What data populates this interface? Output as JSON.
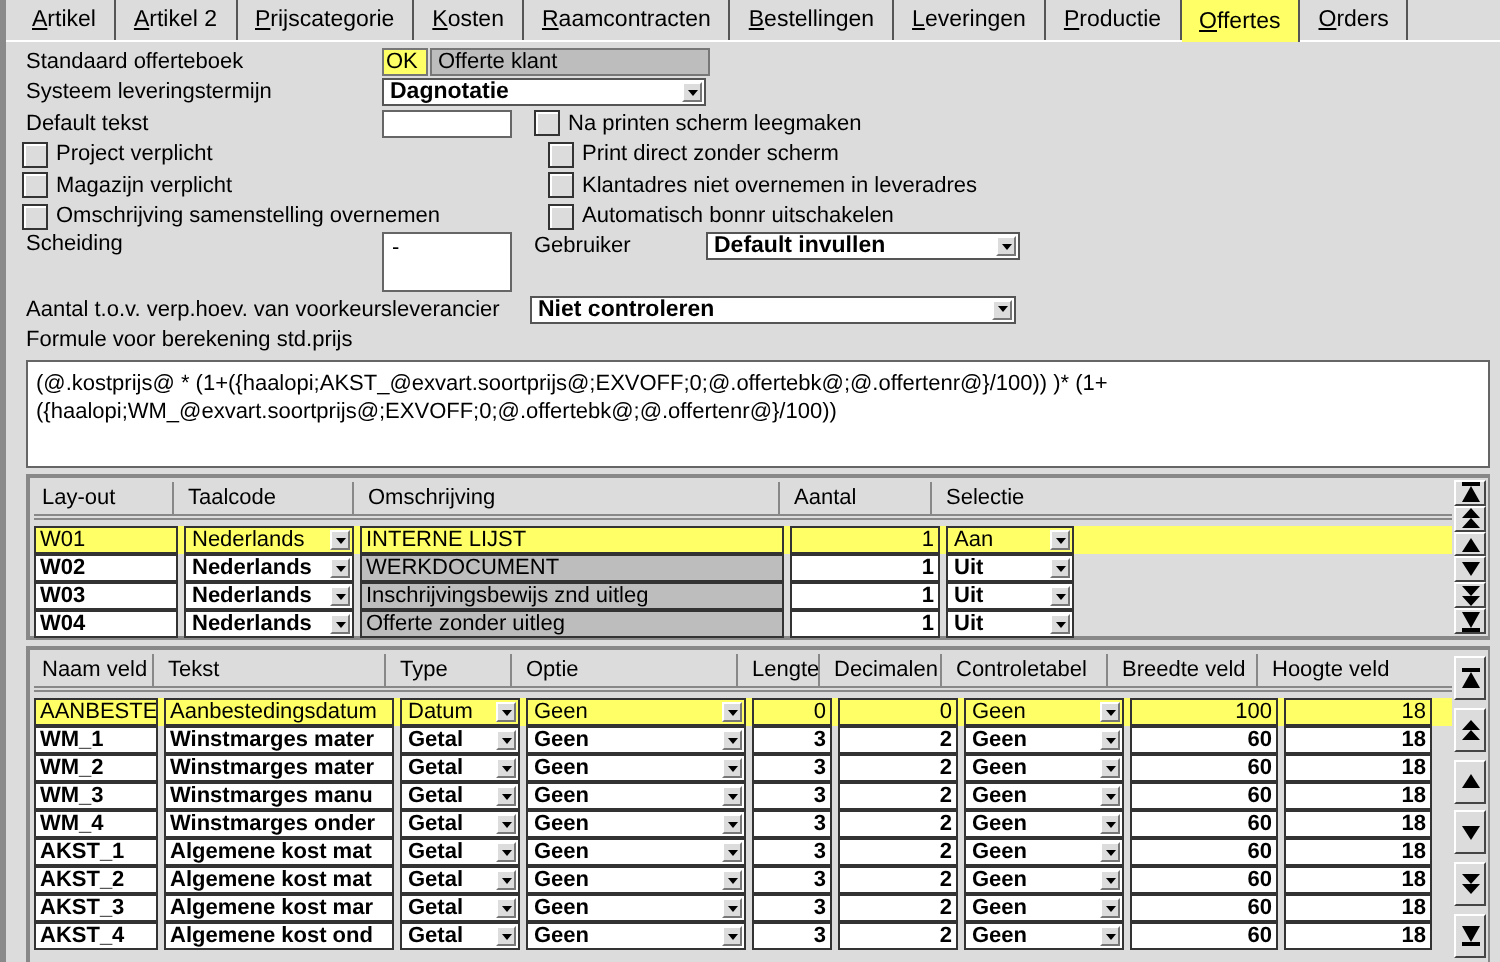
{
  "tabs": [
    {
      "label": "Artikel",
      "selected": false
    },
    {
      "label": "Artikel 2",
      "selected": false
    },
    {
      "label": "Prijscategorie",
      "selected": false
    },
    {
      "label": "Kosten",
      "selected": false
    },
    {
      "label": "Raamcontracten",
      "selected": false
    },
    {
      "label": "Bestellingen",
      "selected": false
    },
    {
      "label": "Leveringen",
      "selected": false
    },
    {
      "label": "Productie",
      "selected": false
    },
    {
      "label": "Offertes",
      "selected": true
    },
    {
      "label": "Orders",
      "selected": false
    }
  ],
  "form": {
    "standaard_offerteboek": {
      "label": "Standaard offerteboek",
      "code": "OK",
      "value": "Offerte klant"
    },
    "systeem_leveringstermijn": {
      "label": "Systeem leveringstermijn",
      "value": "Dagnotatie"
    },
    "default_tekst": {
      "label": "Default tekst"
    },
    "checkboxes_left": [
      {
        "label": "Project verplicht",
        "checked": false
      },
      {
        "label": "Magazijn verplicht",
        "checked": false
      },
      {
        "label": "Omschrijving samenstelling overnemen",
        "checked": false
      }
    ],
    "checkboxes_right": [
      {
        "label": "Na printen scherm leegmaken",
        "checked": false
      },
      {
        "label": "Print direct zonder scherm",
        "checked": false
      },
      {
        "label": "Klantadres niet overnemen in leveradres",
        "checked": false
      },
      {
        "label": "Automatisch bonnr uitschakelen",
        "checked": false
      }
    ],
    "scheiding": {
      "label": "Scheiding",
      "value": "-"
    },
    "gebruiker": {
      "label": "Gebruiker",
      "value": "Default invullen"
    },
    "aantal": {
      "label": "Aantal t.o.v. verp.hoev. van voorkeursleverancier",
      "value": "Niet controleren"
    },
    "formule": {
      "label": "Formule voor berekening std.prijs",
      "value": "(@.kostprijs@ * (1+({haalopi;AKST_@exvart.soortprijs@;EXVOFF;0;@.offertebk@;@.offertenr@}/100)) )* (1+({haalopi;WM_@exvart.soortprijs@;EXVOFF;0;@.offertebk@;@.offertenr@}/100))"
    }
  },
  "layout_table": {
    "columns": [
      "Lay-out",
      "Taalcode",
      "Omschrijving",
      "Aantal",
      "Selectie"
    ],
    "rows": [
      {
        "layout": "W01",
        "taalcode": "Nederlands",
        "omschrijving": "INTERNE LIJST",
        "aantal": "1",
        "selectie": "Aan",
        "selected": true
      },
      {
        "layout": "W02",
        "taalcode": "Nederlands",
        "omschrijving": "WERKDOCUMENT",
        "aantal": "1",
        "selectie": "Uit",
        "selected": false
      },
      {
        "layout": "W03",
        "taalcode": "Nederlands",
        "omschrijving": "Inschrijvingsbewijs znd uitleg",
        "aantal": "1",
        "selectie": "Uit",
        "selected": false
      },
      {
        "layout": "W04",
        "taalcode": "Nederlands",
        "omschrijving": "Offerte zonder uitleg",
        "aantal": "1",
        "selectie": "Uit",
        "selected": false
      }
    ]
  },
  "field_table": {
    "columns": [
      "Naam veld",
      "Tekst",
      "Type",
      "Optie",
      "Lengte",
      "Decimalen",
      "Controletabel",
      "Breedte veld",
      "Hoogte veld"
    ],
    "rows": [
      {
        "naam": "AANBESTE",
        "tekst": "Aanbestedingsdatum",
        "type": "Datum",
        "optie": "Geen",
        "lengte": "0",
        "decimalen": "0",
        "controletabel": "Geen",
        "breedte": "100",
        "hoogte": "18",
        "selected": true
      },
      {
        "naam": "WM_1",
        "tekst": "Winstmarges mater",
        "type": "Getal",
        "optie": "Geen",
        "lengte": "3",
        "decimalen": "2",
        "controletabel": "Geen",
        "breedte": "60",
        "hoogte": "18",
        "selected": false
      },
      {
        "naam": "WM_2",
        "tekst": "Winstmarges mater",
        "type": "Getal",
        "optie": "Geen",
        "lengte": "3",
        "decimalen": "2",
        "controletabel": "Geen",
        "breedte": "60",
        "hoogte": "18",
        "selected": false
      },
      {
        "naam": "WM_3",
        "tekst": "Winstmarges manu",
        "type": "Getal",
        "optie": "Geen",
        "lengte": "3",
        "decimalen": "2",
        "controletabel": "Geen",
        "breedte": "60",
        "hoogte": "18",
        "selected": false
      },
      {
        "naam": "WM_4",
        "tekst": "Winstmarges onder",
        "type": "Getal",
        "optie": "Geen",
        "lengte": "3",
        "decimalen": "2",
        "controletabel": "Geen",
        "breedte": "60",
        "hoogte": "18",
        "selected": false
      },
      {
        "naam": "AKST_1",
        "tekst": "Algemene kost mat",
        "type": "Getal",
        "optie": "Geen",
        "lengte": "3",
        "decimalen": "2",
        "controletabel": "Geen",
        "breedte": "60",
        "hoogte": "18",
        "selected": false
      },
      {
        "naam": "AKST_2",
        "tekst": "Algemene kost mat",
        "type": "Getal",
        "optie": "Geen",
        "lengte": "3",
        "decimalen": "2",
        "controletabel": "Geen",
        "breedte": "60",
        "hoogte": "18",
        "selected": false
      },
      {
        "naam": "AKST_3",
        "tekst": "Algemene kost mar",
        "type": "Getal",
        "optie": "Geen",
        "lengte": "3",
        "decimalen": "2",
        "controletabel": "Geen",
        "breedte": "60",
        "hoogte": "18",
        "selected": false
      },
      {
        "naam": "AKST_4",
        "tekst": "Algemene kost ond",
        "type": "Getal",
        "optie": "Geen",
        "lengte": "3",
        "decimalen": "2",
        "controletabel": "Geen",
        "breedte": "60",
        "hoogte": "18",
        "selected": false
      }
    ]
  }
}
